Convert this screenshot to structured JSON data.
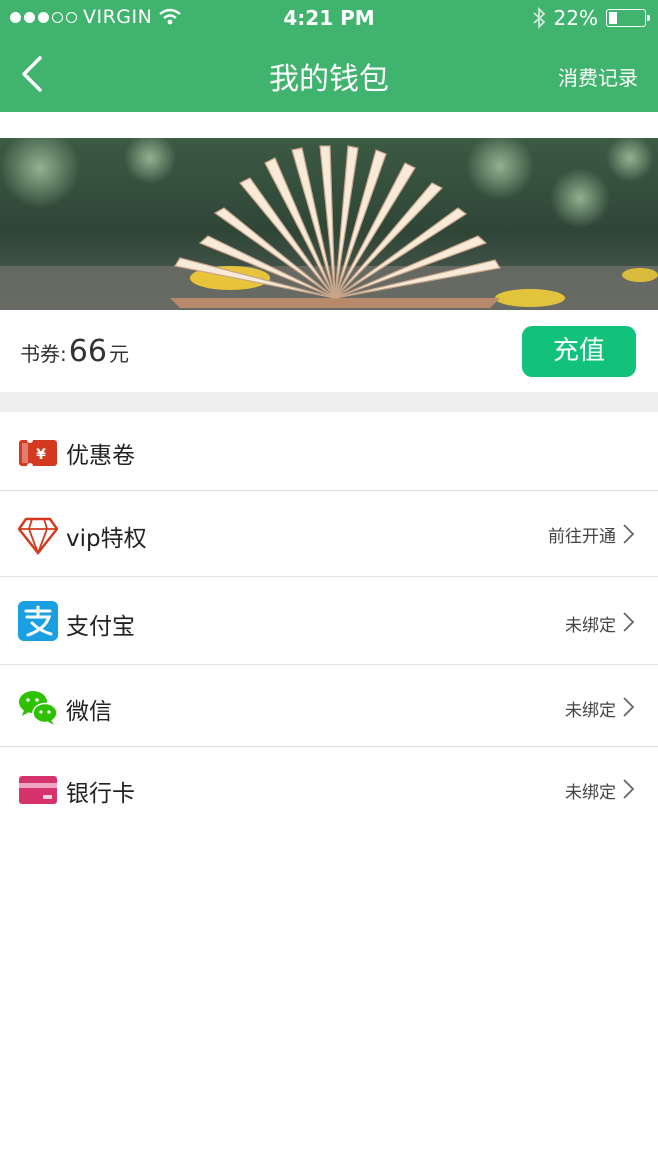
{
  "status_bar": {
    "carrier": "VIRGIN",
    "time": "4:21 PM",
    "battery": "22%",
    "battery_level": 0.22
  },
  "navbar": {
    "title": "我的钱包",
    "right_action": "消费记录",
    "back_icon": "chevron-left-icon"
  },
  "balance": {
    "label": "书券:",
    "amount": "66",
    "unit": "元",
    "recharge_label": "充值"
  },
  "menu": [
    {
      "id": "coupon",
      "title": "优惠卷",
      "status": "",
      "icon": "coupon-ticket-icon"
    },
    {
      "id": "vip",
      "title": "vip特权",
      "status": "前往开通",
      "icon": "diamond-icon"
    },
    {
      "id": "alipay",
      "title": "支付宝",
      "status": "未绑定",
      "icon": "alipay-icon"
    },
    {
      "id": "wechat",
      "title": "微信",
      "status": "未绑定",
      "icon": "wechat-icon"
    },
    {
      "id": "bankcard",
      "title": "银行卡",
      "status": "未绑定",
      "icon": "bank-card-icon"
    }
  ],
  "colors": {
    "header_green": "#40b46e",
    "button_green": "#12c27b",
    "coupon_red": "#d33a1f",
    "alipay_blue": "#1a9fe0",
    "wechat_green": "#2dc100",
    "bank_pink": "#d6336c"
  }
}
